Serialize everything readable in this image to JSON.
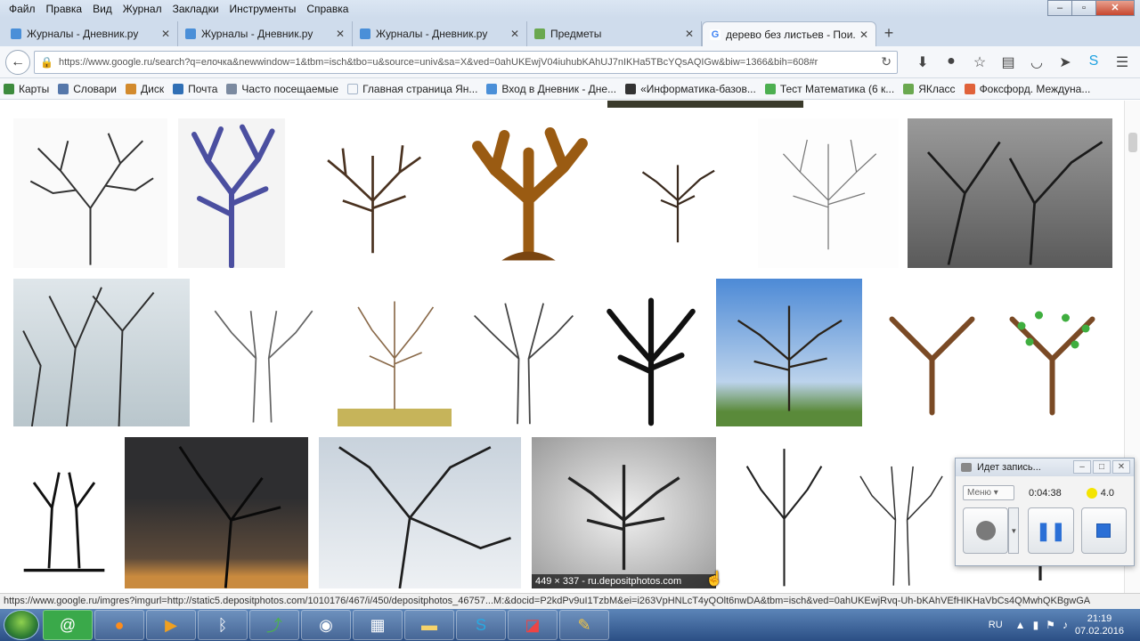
{
  "menubar": {
    "items": [
      "Файл",
      "Правка",
      "Вид",
      "Журнал",
      "Закладки",
      "Инструменты",
      "Справка"
    ],
    "window_controls": [
      "‒",
      "▫",
      "✕"
    ]
  },
  "tabs": [
    {
      "label": "Журналы - Дневник.ру",
      "icon": "dnevnik-icon",
      "color": "#4a8fd8"
    },
    {
      "label": "Журналы - Дневник.ру",
      "icon": "dnevnik-icon",
      "color": "#4a8fd8"
    },
    {
      "label": "Журналы - Дневник.ру",
      "icon": "dnevnik-icon",
      "color": "#4a8fd8"
    },
    {
      "label": "Предметы",
      "icon": "subjects-icon",
      "color": "#6aa84f"
    },
    {
      "label": "дерево без листьев - Пои...",
      "icon": "google-icon",
      "color": "#4285f4",
      "active": true
    }
  ],
  "navbar": {
    "url": "https://www.google.ru/search?q=елочка&newwindow=1&tbm=isch&tbo=u&source=univ&sa=X&ved=0ahUKEwjV04iuhubKAhUJ7nIKHa5TBcYQsAQIGw&biw=1366&bih=608#r"
  },
  "bookmarks": [
    {
      "label": "Карты",
      "color": "#3d8b3d"
    },
    {
      "label": "Словари",
      "color": "#5577aa"
    },
    {
      "label": "Диск",
      "color": "#d28a2c"
    },
    {
      "label": "Почта",
      "color": "#2f6fb5"
    },
    {
      "label": "Часто посещаемые",
      "color": "#7b8aa0"
    },
    {
      "label": "Главная страница Ян...",
      "color": "#a4b4c8"
    },
    {
      "label": "Вход в Дневник - Дне...",
      "color": "#4a8fd8"
    },
    {
      "label": "«Информатика-базов...",
      "color": "#333333"
    },
    {
      "label": "Тест Математика (6 к...",
      "color": "#4caf50"
    },
    {
      "label": "ЯКласс",
      "color": "#6aa84f"
    },
    {
      "label": "Фоксфорд. Междуна...",
      "color": "#e0623a"
    }
  ],
  "images": {
    "caption": "449 × 337 - ru.depositphotos.com"
  },
  "status_url": "https://www.google.ru/imgres?imgurl=http://static5.depositphotos.com/1010176/467/i/450/depositphotos_46757...M:&docid=P2kdPv9uI1TzbM&ei=i263VpHNLcT4yQOlt6nwDA&tbm=isch&ved=0ahUKEwjRvq-Uh-bKAhVEfHIKHaVbCs4QMwhQKBgwGA",
  "taskbar": {
    "apps": [
      "mail-agent-icon",
      "firefox-icon",
      "video-player-icon",
      "bluetooth-icon",
      "chart-app-icon",
      "wifi-icon",
      "calendar-icon",
      "folder-icon",
      "skype-icon",
      "presentation-icon",
      "paint-icon"
    ],
    "language": "RU",
    "time": "21:19",
    "date": "07.02.2016"
  },
  "recorder": {
    "title": "Идет запись...",
    "menu": "Меню",
    "time": "0:04:38",
    "level": "4.0"
  }
}
